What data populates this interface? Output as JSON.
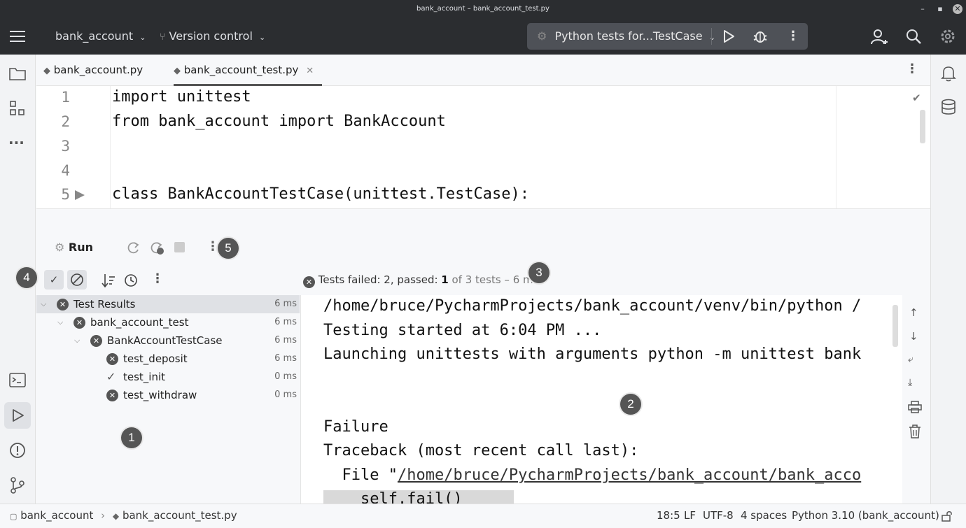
{
  "window": {
    "title": "bank_account – bank_account_test.py"
  },
  "toolbar": {
    "project": "bank_account",
    "vcs": "Version control",
    "run_config": "Python tests for...TestCase"
  },
  "tabs": [
    {
      "label": "bank_account.py"
    },
    {
      "label": "bank_account_test.py",
      "active": true
    }
  ],
  "editor": {
    "lines": [
      {
        "num": "1",
        "code": "import unittest"
      },
      {
        "num": "2",
        "code": "from bank_account import BankAccount"
      },
      {
        "num": "3",
        "code": ""
      },
      {
        "num": "4",
        "code": ""
      },
      {
        "num": "5",
        "code": "class BankAccountTestCase(unittest.TestCase):"
      }
    ]
  },
  "run_panel": {
    "title": "Run",
    "summary": {
      "failed_label": "Tests failed: ",
      "failed_count": "2",
      "passed_label": ", passed: ",
      "passed_count": "1",
      "rest": " of 3 tests – 6 ms"
    }
  },
  "tree": [
    {
      "label": "Test Results",
      "duration": "6 ms",
      "status": "failed"
    },
    {
      "label": "bank_account_test",
      "duration": "6 ms",
      "status": "failed"
    },
    {
      "label": "BankAccountTestCase",
      "duration": "6 ms",
      "status": "failed"
    },
    {
      "label": "test_deposit",
      "duration": "6 ms",
      "status": "failed"
    },
    {
      "label": "test_init",
      "duration": "0 ms",
      "status": "passed"
    },
    {
      "label": "test_withdraw",
      "duration": "0 ms",
      "status": "failed"
    }
  ],
  "console": {
    "lines": [
      "/home/bruce/PycharmProjects/bank_account/venv/bin/python /",
      "Testing started at 6:04 PM ...",
      "Launching unittests with arguments python -m unittest bank",
      "",
      "",
      "Failure",
      "Traceback (most recent call last):"
    ],
    "file_prefix": "  File \"",
    "file_link": "/home/bruce/PycharmProjects/bank_account/bank_acco",
    "last_line": "    self.fail()"
  },
  "badges": [
    "1",
    "2",
    "3",
    "4",
    "5"
  ],
  "statusbar": {
    "crumb_project": "bank_account",
    "crumb_file": "bank_account_test.py",
    "position": "18:5",
    "line_sep": "LF",
    "encoding": "UTF-8",
    "indent": "4 spaces",
    "interpreter": "Python 3.10 (bank_account)"
  }
}
